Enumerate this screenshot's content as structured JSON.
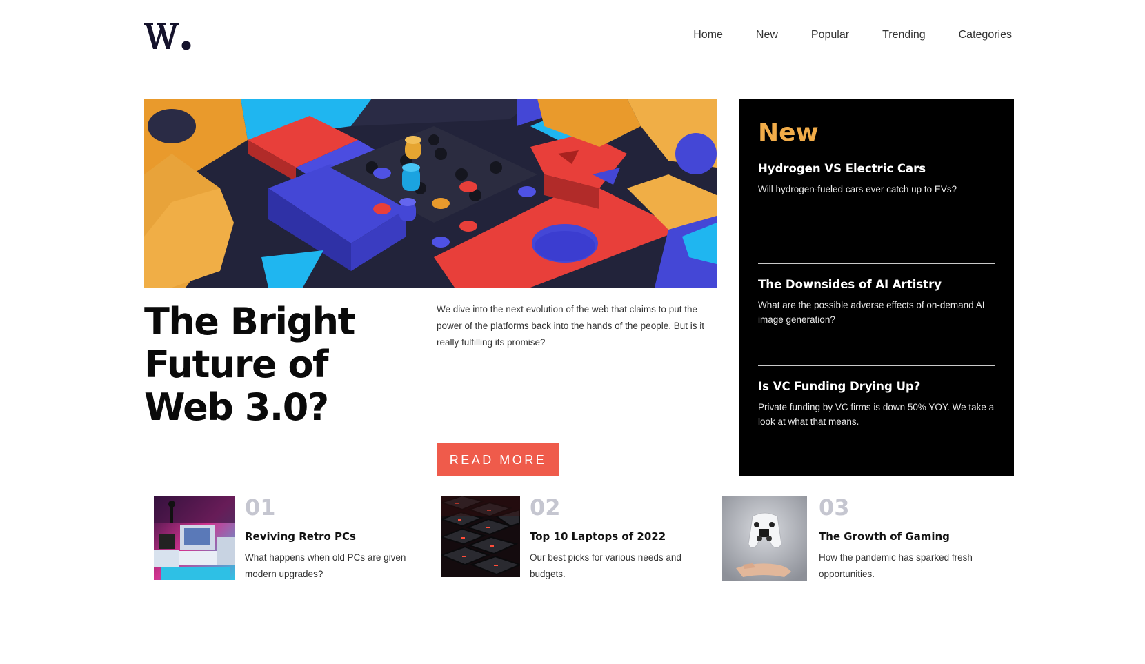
{
  "header": {
    "logo_text": "W.",
    "nav": [
      "Home",
      "New",
      "Popular",
      "Trending",
      "Categories"
    ]
  },
  "hero": {
    "title": "The Bright Future of Web 3.0?",
    "description": "We dive into the next evolution of the web that claims to put the power of the platforms back into the hands of the people. But is it really fulfilling its promise?",
    "button_label": "READ MORE"
  },
  "new_panel": {
    "heading": "New",
    "items": [
      {
        "title": "Hydrogen VS Electric Cars",
        "desc": "Will hydrogen-fueled cars ever catch up to EVs?"
      },
      {
        "title": "The Downsides of AI Artistry",
        "desc": "What are the possible adverse effects of on-demand AI image generation?"
      },
      {
        "title": "Is VC Funding Drying Up?",
        "desc": "Private funding by VC firms is down 50% YOY. We take a look at what that means."
      }
    ]
  },
  "articles": [
    {
      "num": "01",
      "title": "Reviving Retro PCs",
      "desc": "What happens when old PCs are given modern upgrades?",
      "image": "retro-pc-image"
    },
    {
      "num": "02",
      "title": "Top 10 Laptops of 2022",
      "desc": "Our best picks for various needs and budgets.",
      "image": "laptop-keyboard-image"
    },
    {
      "num": "03",
      "title": "The Growth of Gaming",
      "desc": "How the pandemic has sparked fresh opportunities.",
      "image": "gaming-controller-image"
    }
  ],
  "colors": {
    "accent_orange": "#f1ac49",
    "button_red": "#ef5b4b",
    "panel_black": "#000000",
    "number_gray": "#c5c6d0"
  }
}
